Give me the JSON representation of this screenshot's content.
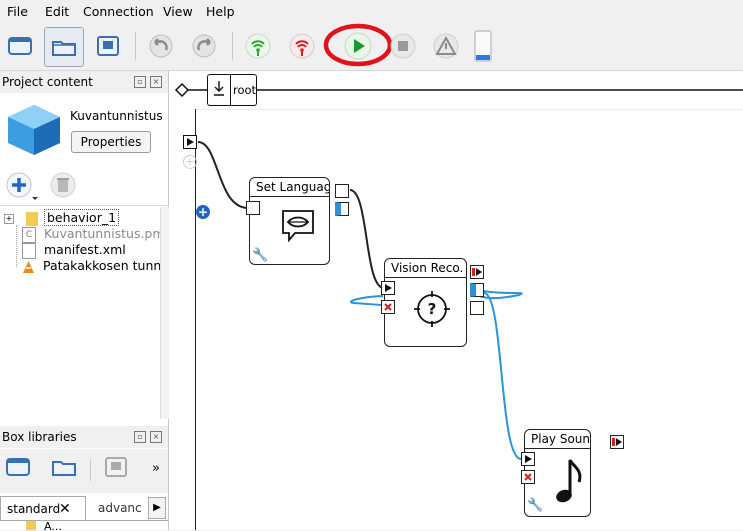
{
  "menu": {
    "file": "File",
    "edit": "Edit",
    "connection": "Connection",
    "view": "View",
    "help": "Help"
  },
  "toolbar": {
    "icons": [
      "new-window-icon",
      "open-folder-icon",
      "save-icon",
      "undo-icon",
      "redo-icon",
      "connect-icon",
      "disconnect-icon",
      "play-icon",
      "stop-icon",
      "warning-icon",
      "battery-icon"
    ],
    "highlight_color": "#e0121b",
    "play_color": "#1a9a2a"
  },
  "project": {
    "panel_title": "Project content",
    "name": "Kuvantunnistus",
    "properties_label": "Properties"
  },
  "tree": {
    "items": [
      {
        "label": "behavior_1"
      },
      {
        "label": "Kuvantunnistus.pml"
      },
      {
        "label": "manifest.xml"
      },
      {
        "label": "Patakakkosen tunn..."
      }
    ]
  },
  "box_libraries": {
    "panel_title": "Box libraries",
    "more": "»",
    "tabs": [
      "standard",
      "advanc"
    ],
    "next_item": "A..."
  },
  "breadcrumb": {
    "root": "root"
  },
  "boxes": {
    "set_language": "Set Language",
    "vision_reco": "Vision Reco.",
    "play_sound": "Play Sound"
  },
  "colors": {
    "wire_black": "#222222",
    "wire_blue": "#2b93d6",
    "port_blue": "#2b93d6",
    "stop_red": "#d42020"
  }
}
